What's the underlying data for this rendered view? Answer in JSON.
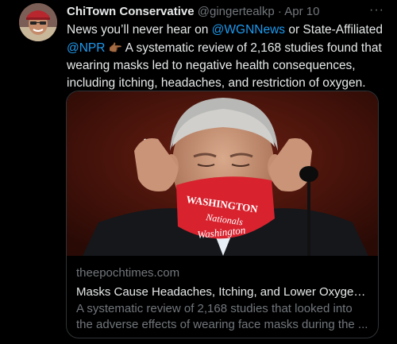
{
  "tweet": {
    "display_name": "ChiTown Conservative",
    "handle": "@gingertealkp",
    "separator": "·",
    "time": "Apr 10",
    "more_icon": "···",
    "text_part1": "News you’ll never hear on ",
    "mention1": "@WGNNews",
    "text_part2": " or State-Affiliated ",
    "mention2": "@NPR",
    "pointing_emoji": "👉🏾",
    "text_part3": " A systematic review of 2,168 studies found that wearing masks led to negative health consequences, including itching, headaches, and restriction of oxygen."
  },
  "card": {
    "domain": "theepochtimes.com",
    "title": "Masks Cause Headaches, Itching, and Lower Oxygen I...",
    "description": "A systematic review of 2,168 studies that looked into the adverse effects of wearing face masks during the ...",
    "mask_text": [
      "WASHINGTON",
      "Nationals",
      "Washington"
    ]
  },
  "colors": {
    "background": "#000000",
    "text": "#e7e9ea",
    "secondary": "#71767b",
    "link": "#1d9bf0",
    "border": "#2f3336",
    "mask": "#d8232f"
  }
}
